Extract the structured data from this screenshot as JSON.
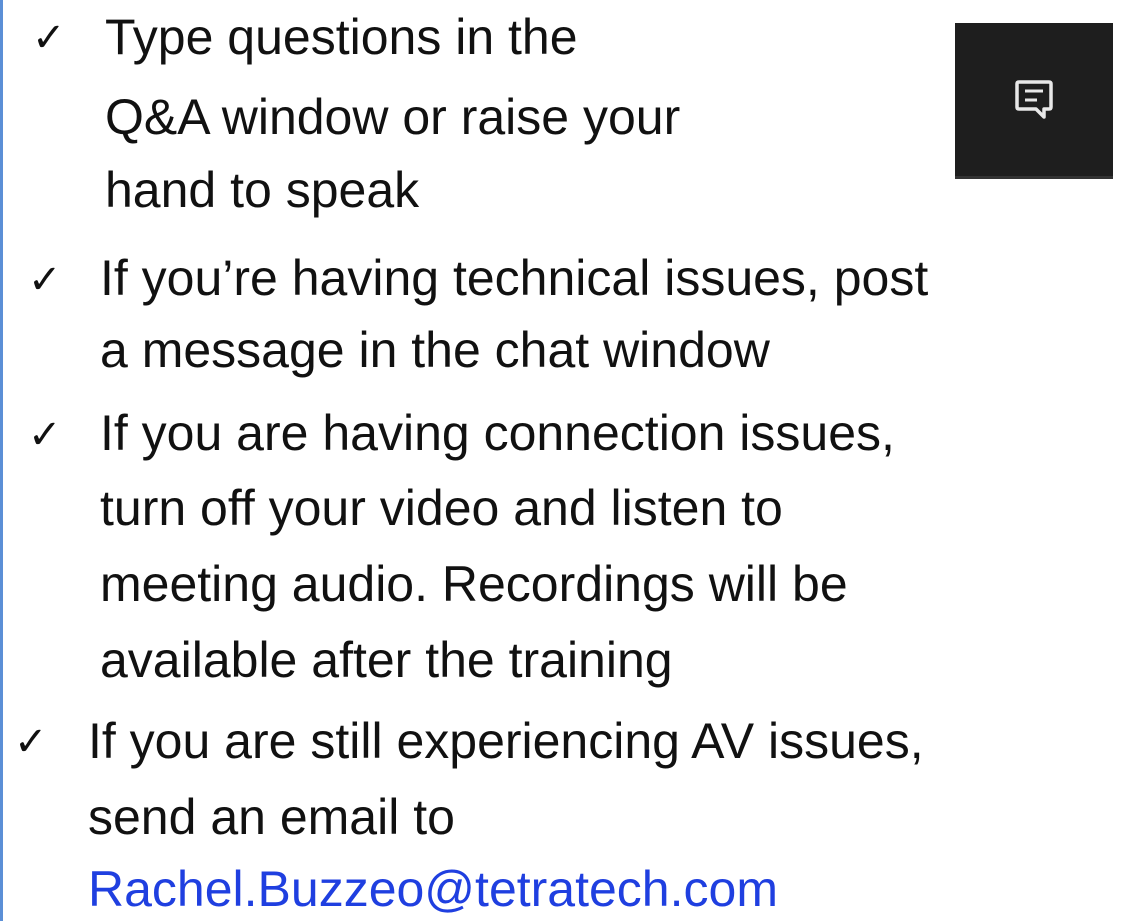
{
  "bullets": [
    {
      "check": "✓",
      "lines": [
        "Type questions in the",
        "Q&A window or raise your",
        "hand to speak"
      ]
    },
    {
      "check": "✓",
      "lines": [
        "If you’re having technical issues, post",
        "a message in the chat window"
      ]
    },
    {
      "check": "✓",
      "lines": [
        "If you are having connection issues,",
        "turn off your video and listen to",
        "meeting audio. Recordings will be",
        "available after the training"
      ]
    },
    {
      "check": "✓",
      "lines": [
        "If you are still experiencing AV issues,",
        "send an email to"
      ]
    }
  ],
  "email": "Rachel.Buzzeo@tetratech.com",
  "chat_button": {
    "icon": "chat-icon"
  },
  "colors": {
    "link": "#1f3fe0",
    "button_bg": "#1e1e1e",
    "rule": "#5b8fd6"
  }
}
